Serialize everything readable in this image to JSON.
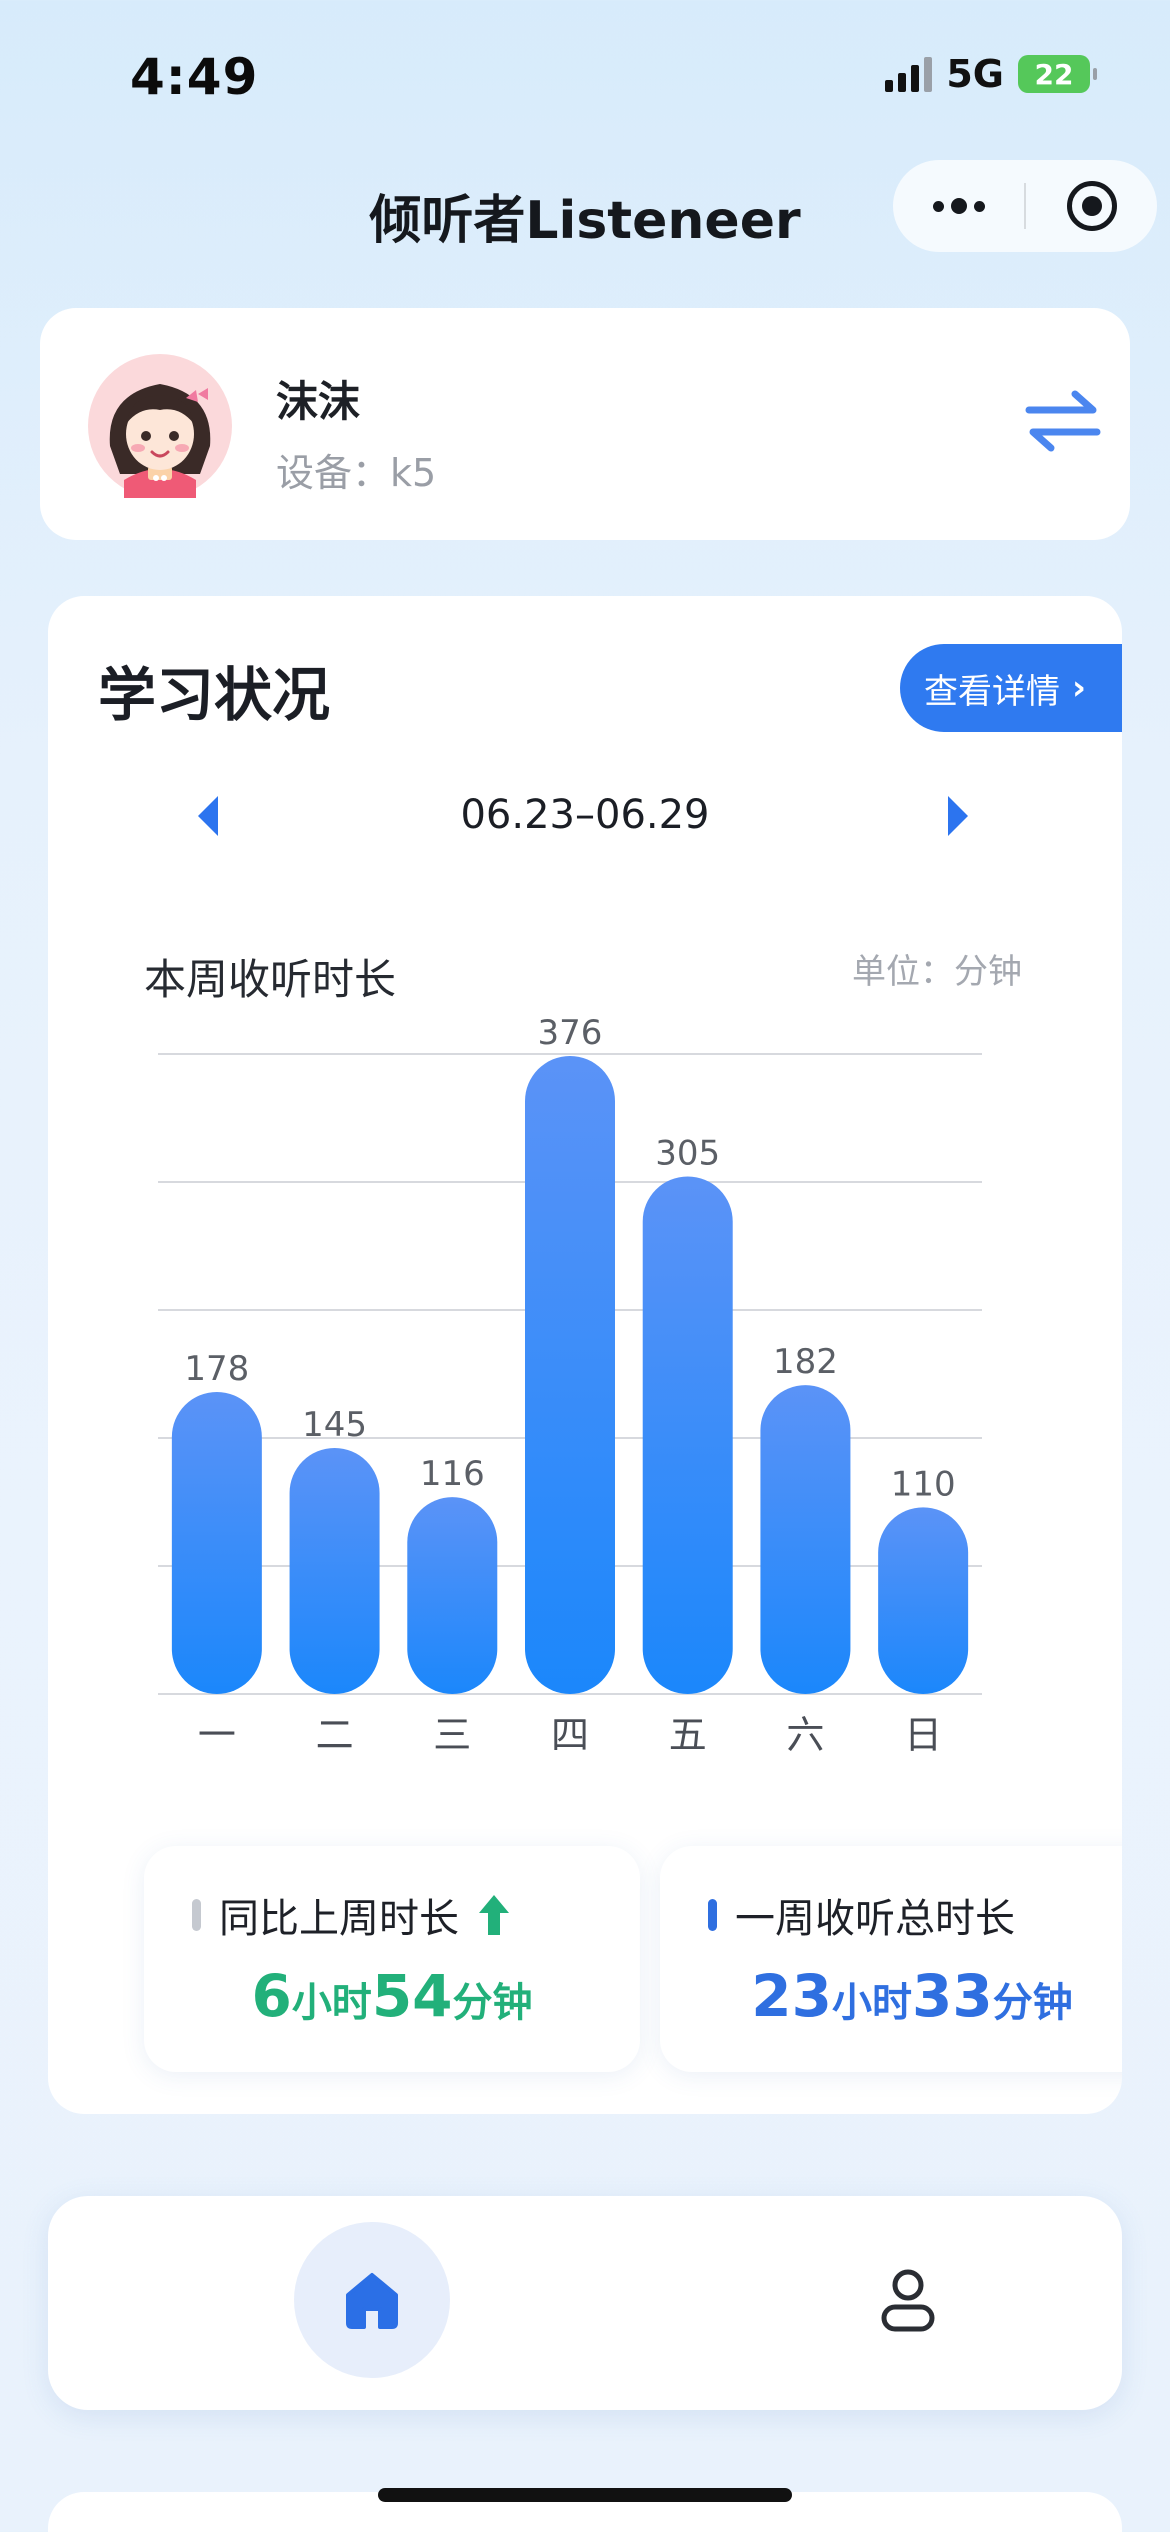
{
  "status_bar": {
    "time": "4:49",
    "network": "5G",
    "battery": "22"
  },
  "nav": {
    "title": "倾听者Listeneer",
    "more_icon": "more-dots-icon",
    "close_icon": "target-icon"
  },
  "profile": {
    "name": "沫沫",
    "device": "设备：k5",
    "switch_icon": "swap-arrows-icon"
  },
  "study": {
    "title": "学习状况",
    "detail_button": "查看详情",
    "week_range": "06.23–06.29",
    "chart_caption": "本周收听时长",
    "unit": "单位：分钟"
  },
  "chart_data": {
    "type": "bar",
    "categories": [
      "一",
      "二",
      "三",
      "四",
      "五",
      "六",
      "日"
    ],
    "values": [
      178,
      145,
      116,
      376,
      305,
      182,
      110
    ],
    "ylim": [
      0,
      376
    ],
    "grid": true,
    "colors": {
      "top": "#5b93f7",
      "bottom": "#1b87fb"
    }
  },
  "stats": {
    "week_compare": {
      "label": "同比上周时长",
      "hours": "6",
      "hours_unit": "小时",
      "minutes": "54",
      "minutes_unit": "分钟",
      "color": "#22b07a",
      "trend_icon": "arrow-up-icon"
    },
    "week_total": {
      "label": "一周收听总时长",
      "hours": "23",
      "hours_unit": "小时",
      "minutes": "33",
      "minutes_unit": "分钟",
      "color": "#2f6fe0"
    }
  },
  "tabbar": {
    "home_icon": "home-icon",
    "profile_icon": "user-icon"
  }
}
